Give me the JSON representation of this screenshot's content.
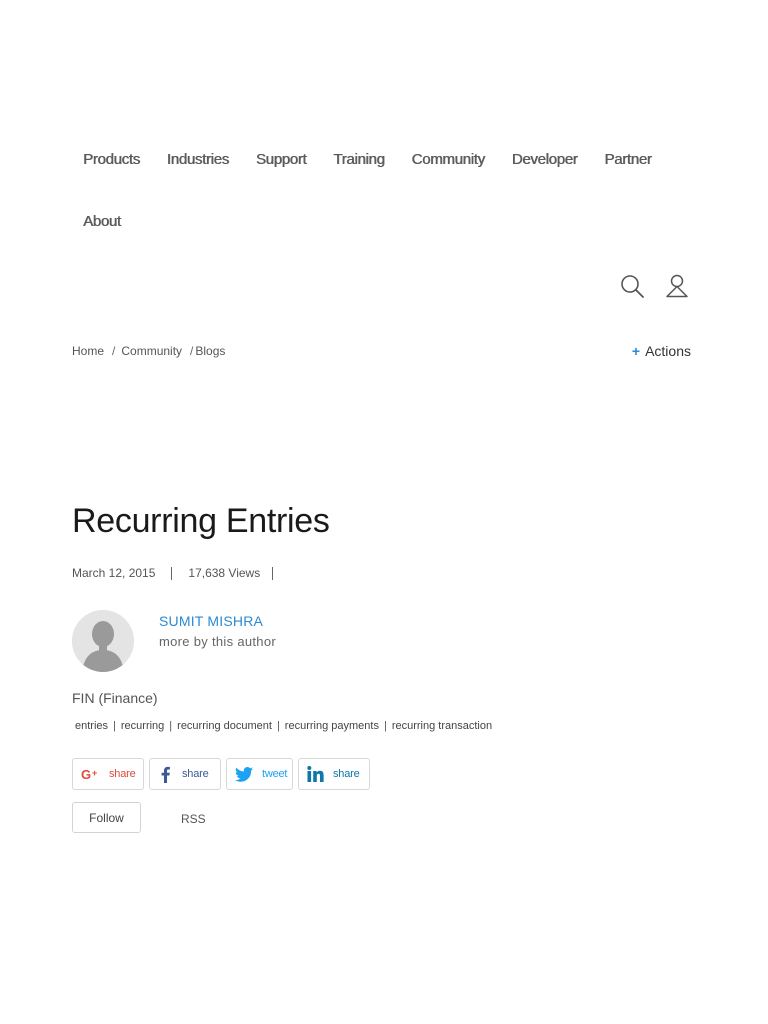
{
  "nav": {
    "items": [
      "Products",
      "Industries",
      "Support",
      "Training",
      "Community",
      "Developer",
      "Partner",
      "About"
    ]
  },
  "header": {
    "search_icon": "search-icon",
    "user_icon": "user-icon"
  },
  "breadcrumb": {
    "items": [
      "Home",
      "Community",
      "Blogs"
    ],
    "separator": "/"
  },
  "actions": {
    "plus": "+",
    "label": "Actions"
  },
  "post": {
    "title": "Recurring Entries",
    "date": "March 12, 2015",
    "views": "17,638 Views",
    "author_name": "SUMIT MISHRA",
    "author_more": "more by this author",
    "category": "FIN (Finance)",
    "tags": [
      "entries",
      "recurring",
      "recurring document",
      "recurring payments",
      "recurring transaction"
    ],
    "tag_separator": "|"
  },
  "share": {
    "gplus": "share",
    "facebook": "share",
    "twitter": "tweet",
    "linkedin": "share"
  },
  "follow": {
    "follow_label": "Follow",
    "rss_label": "RSS"
  },
  "colors": {
    "accent": "#2a8ad4",
    "gplus": "#dd4b39",
    "facebook": "#3b5998",
    "twitter": "#1da1f2",
    "linkedin": "#0e76a8"
  }
}
